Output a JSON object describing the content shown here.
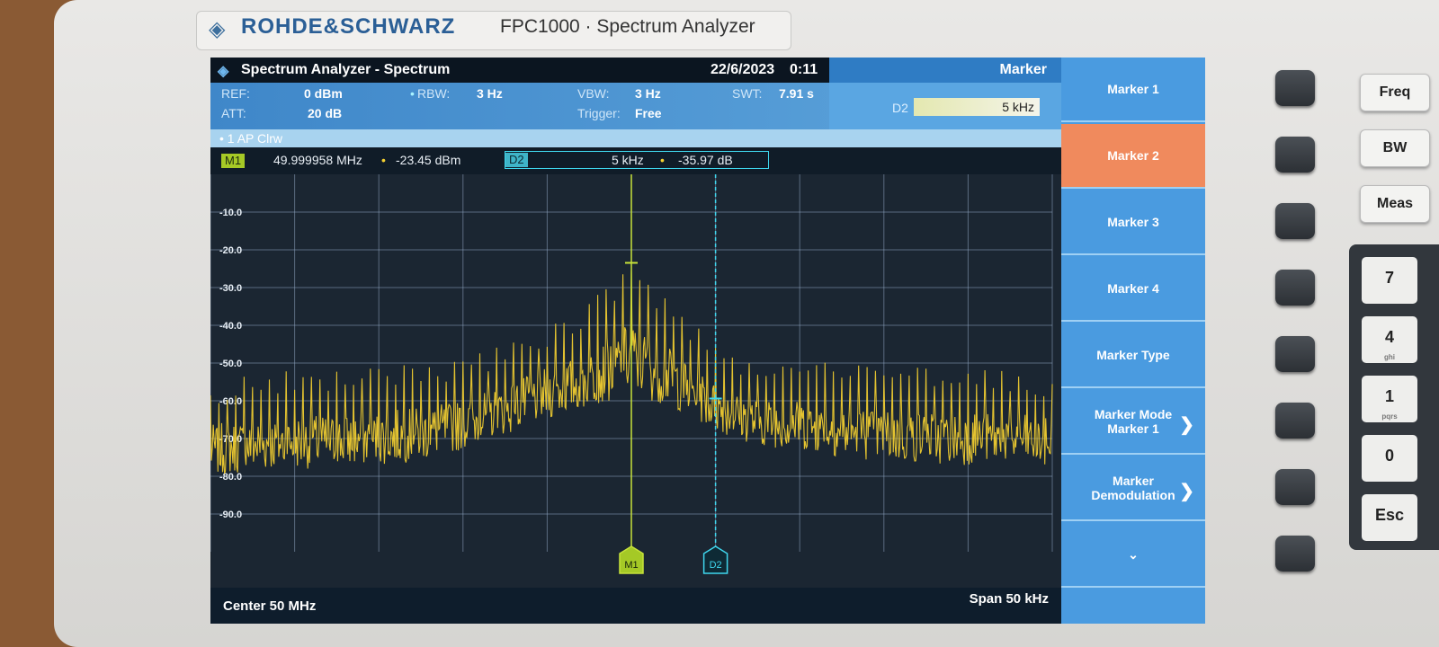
{
  "device": {
    "brand": "ROHDE&SCHWARZ",
    "model": "FPC1000 · Spectrum Analyzer"
  },
  "title_bar": {
    "app_title": "Spectrum Analyzer - Spectrum",
    "date": "22/6/2023",
    "time": "0:11",
    "menu_title": "Marker"
  },
  "settings": {
    "ref_label": "REF:",
    "ref_value": "0 dBm",
    "att_label": "ATT:",
    "att_value": "20 dB",
    "rbw_label": "RBW:",
    "rbw_value": "3 Hz",
    "vbw_label": "VBW:",
    "vbw_value": "3 Hz",
    "trigger_label": "Trigger:",
    "trigger_value": "Free",
    "swt_label": "SWT:",
    "swt_value": "7.91 s",
    "delta_input_label": "D2",
    "delta_input_value": "5 kHz"
  },
  "trace": {
    "label": "• 1 AP  Clrw"
  },
  "markers": {
    "m1_label": "M1",
    "m1_freq": "49.999958 MHz",
    "m1_level": "-23.45 dBm",
    "d2_label": "D2",
    "d2_freq": "5 kHz",
    "d2_level": "-35.97 dB"
  },
  "bottom": {
    "center": "Center 50 MHz",
    "span": "Span 50 kHz"
  },
  "softkeys": [
    {
      "label": "Marker 1",
      "active": false
    },
    {
      "label": "Marker 2",
      "active": true
    },
    {
      "label": "Marker 3",
      "active": false
    },
    {
      "label": "Marker 4",
      "active": false
    },
    {
      "label": "Marker Type",
      "active": false
    },
    {
      "label": "Marker Mode Marker 1",
      "active": false
    },
    {
      "label": "Marker Demodulation",
      "active": false
    },
    {
      "label": "⌄",
      "active": false
    }
  ],
  "right_keys": [
    "Freq",
    "BW",
    "Meas"
  ],
  "numpad": [
    {
      "digit": "7",
      "sub": ""
    },
    {
      "digit": "4",
      "sub": "ghi"
    },
    {
      "digit": "1",
      "sub": "pqrs"
    },
    {
      "digit": "0",
      "sub": ""
    },
    {
      "digit": "Esc",
      "sub": ""
    }
  ],
  "colors": {
    "trace": "#f5d030",
    "marker1": "#c7e23a",
    "delta2": "#3fd7ee",
    "accent": "#4a9be0",
    "active_softkey": "#f08a5d"
  },
  "chart_data": {
    "type": "line",
    "title": "",
    "xlabel": "",
    "ylabel": "",
    "x_center_mhz": 50,
    "span_khz": 50,
    "xlim_khz": [
      -25,
      25
    ],
    "ylim": [
      -100,
      0
    ],
    "y_ticks": [
      "-10.0",
      "-20.0",
      "-30.0",
      "-40.0",
      "-50.0",
      "-60.0",
      "-70.0",
      "-80.0",
      "-90.0"
    ],
    "grid": true,
    "x_grid_divisions": 10,
    "series": [
      {
        "x_khz": [
          -25,
          -22.5,
          -20,
          -17.5,
          -15,
          -12.5,
          -10,
          -7.5,
          -5,
          -2.5,
          0,
          2.5,
          5,
          7.5,
          10,
          12.5,
          15,
          17.5,
          20,
          22.5,
          25
        ],
        "floor_db": [
          -80,
          -79,
          -78,
          -78,
          -77,
          -76,
          -73,
          -69,
          -65,
          -62,
          -58,
          -62,
          -68,
          -72,
          -73,
          -75,
          -76,
          -77,
          -77,
          -77,
          -78
        ],
        "peak_db": [
          -55,
          -53,
          -52,
          -52,
          -51,
          -50,
          -49,
          -45,
          -40,
          -34,
          -23.5,
          -34,
          -45,
          -49,
          -49,
          -50,
          -51,
          -51,
          -51,
          -52,
          -53
        ]
      }
    ],
    "markers": [
      {
        "name": "M1",
        "x_khz": 0,
        "y_db": -23.45
      },
      {
        "name": "D2",
        "x_khz": 5,
        "y_db": -59.4
      }
    ]
  }
}
